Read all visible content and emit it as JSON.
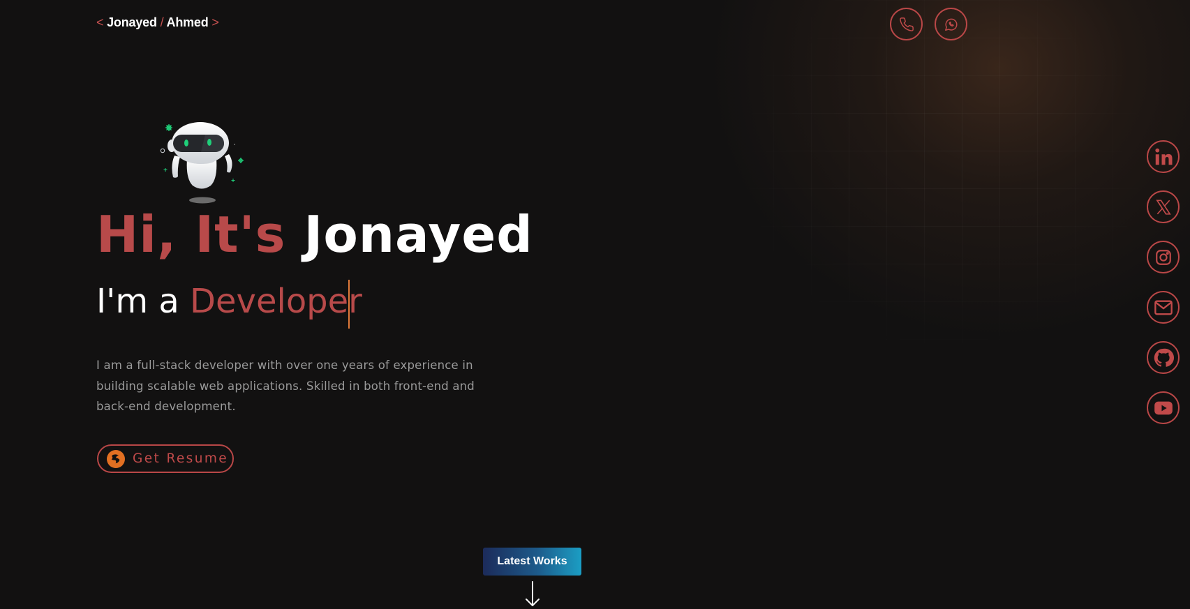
{
  "header": {
    "logo": {
      "open": "<",
      "first": "Jonayed",
      "sep": "/",
      "last": "Ahmed",
      "close": ">"
    },
    "contact_buttons": [
      {
        "name": "phone-icon"
      },
      {
        "name": "whatsapp-icon"
      }
    ]
  },
  "hero": {
    "greeting": "Hi, It's",
    "name": "Jonayed",
    "role_prefix": "I'm a",
    "role": "Developer",
    "bio": "I am a full-stack developer with over one years of experience in building scalable web applications. Skilled in both front-end and back-end development.",
    "resume_label": "Get Resume"
  },
  "social": [
    {
      "name": "linkedin-icon"
    },
    {
      "name": "x-twitter-icon"
    },
    {
      "name": "instagram-icon"
    },
    {
      "name": "email-icon"
    },
    {
      "name": "github-icon"
    },
    {
      "name": "youtube-icon"
    }
  ],
  "latest_works": {
    "label": "Latest Works"
  },
  "colors": {
    "background": "#121111",
    "accent_red": "#b84a4a",
    "caret_orange": "#e07a3a",
    "bio_gray": "#9a9a9a",
    "resume_icon_orange": "#e27022"
  }
}
